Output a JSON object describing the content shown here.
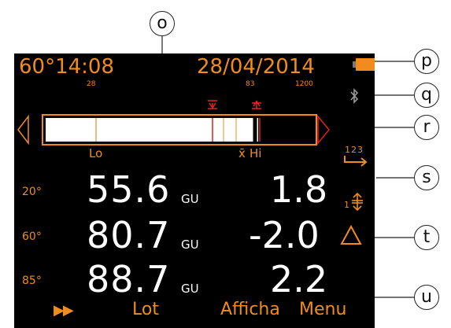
{
  "header": {
    "angle_time": "60°14:08",
    "date": "28/04/2014"
  },
  "scale": {
    "tick_28": "28",
    "tick_83": "83",
    "tick_1200": "1200",
    "lo_label": "Lo",
    "xbar_label": "x̄",
    "hi_label": "Hi"
  },
  "readings": [
    {
      "angle": "20°",
      "value": "55.6",
      "unit": "GU",
      "deviation": "1.8"
    },
    {
      "angle": "60°",
      "value": "80.7",
      "unit": "GU",
      "deviation": "-2.0"
    },
    {
      "angle": "85°",
      "value": "88.7",
      "unit": "GU",
      "deviation": "2.2"
    }
  ],
  "order_indicator": "123",
  "limit_indicator": "1",
  "softkeys": {
    "play": "▶▶",
    "lot": "Lot",
    "display": "Afficha",
    "menu": "Menu"
  },
  "callouts": [
    "o",
    "p",
    "q",
    "r",
    "s",
    "t",
    "u"
  ],
  "colors": {
    "accent": "#f08c1e",
    "red": "#e02020",
    "background": "#000000"
  },
  "icons": [
    "battery-icon",
    "bluetooth-icon",
    "delta-icon",
    "tolerance-icon",
    "order-arrow-icon"
  ]
}
